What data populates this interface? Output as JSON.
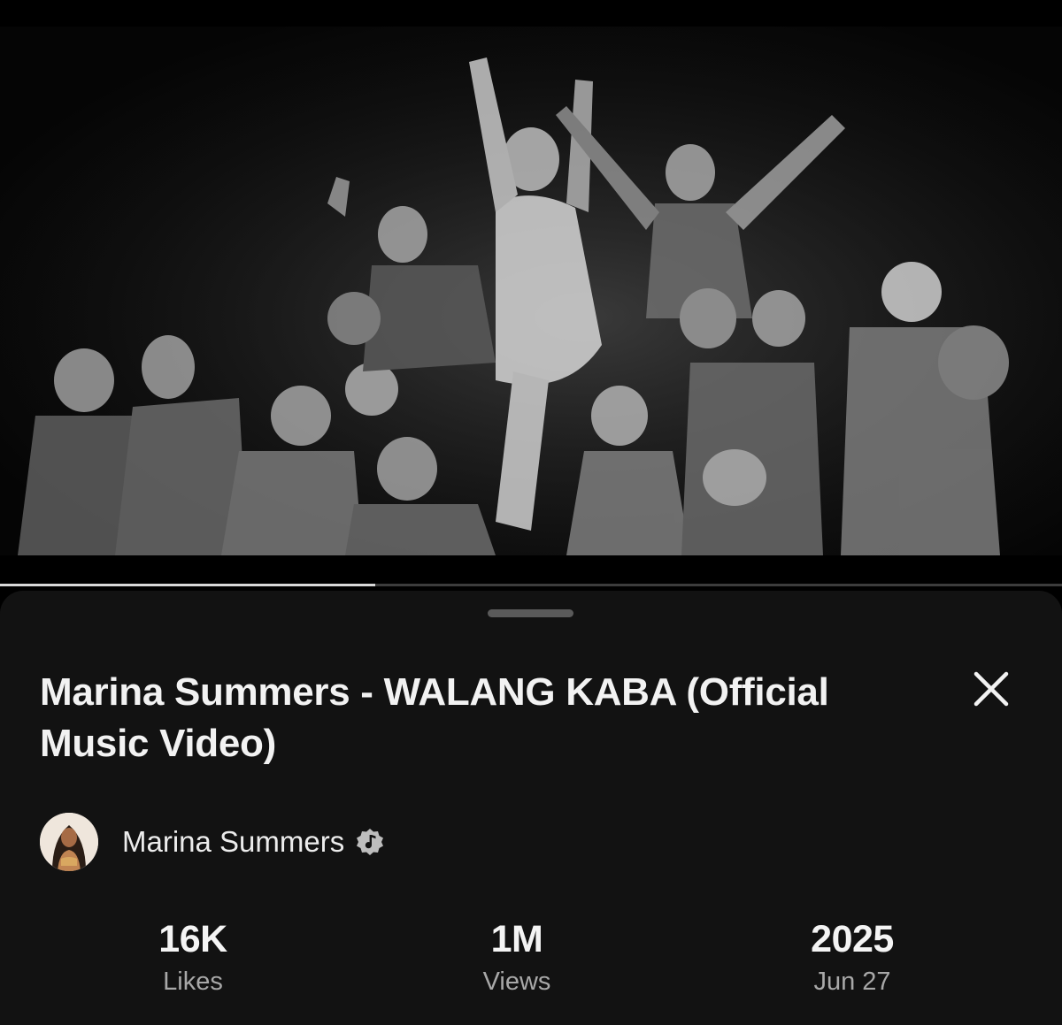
{
  "video": {
    "thumbnail_icon": "dance-group-photo",
    "progress_fraction": 0.353
  },
  "sheet": {
    "title": "Marina Summers - WALANG KABA (Official Music Video)",
    "close_icon": "close-icon",
    "channel": {
      "name": "Marina Summers",
      "verified_icon": "music-note-badge-icon"
    },
    "stats": [
      {
        "value": "16K",
        "label": "Likes"
      },
      {
        "value": "1M",
        "label": "Views"
      },
      {
        "value": "2025",
        "label": "Jun 27"
      }
    ]
  },
  "colors": {
    "background": "#000000",
    "sheet": "#121212",
    "text_primary": "#f2f2f2",
    "text_secondary": "#a8a8a8",
    "progress_fill": "#d9d9d9",
    "progress_track": "#3c3c3c"
  }
}
